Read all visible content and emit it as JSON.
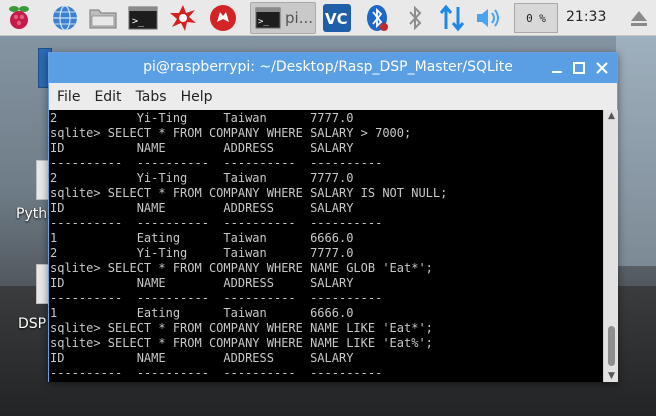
{
  "taskbar": {
    "task_label": "pi...",
    "cpu_usage": "0 %",
    "clock": "21:33",
    "icons": [
      "raspberry-pi-menu-icon",
      "web-browser-icon",
      "file-manager-icon",
      "terminal-icon",
      "burst-app-icon",
      "wolfram-icon",
      "vnc-icon",
      "bluetooth-icon",
      "network-icon",
      "volume-icon",
      "eject-icon"
    ]
  },
  "desktop": {
    "labels": [
      "Pyth",
      "DSP"
    ]
  },
  "window": {
    "title": "pi@raspberrypi: ~/Desktop/Rasp_DSP_Master/SQLite",
    "menu": [
      "File",
      "Edit",
      "Tabs",
      "Help"
    ]
  },
  "terminal": {
    "lines": [
      "2           Yi-Ting     Taiwan      7777.0",
      "sqlite> SELECT * FROM COMPANY WHERE SALARY > 7000;",
      "ID          NAME        ADDRESS     SALARY",
      "----------  ----------  ----------  ----------",
      "2           Yi-Ting     Taiwan      7777.0",
      "sqlite> SELECT * FROM COMPANY WHERE SALARY IS NOT NULL;",
      "ID          NAME        ADDRESS     SALARY",
      "----------  ----------  ----------  ----------",
      "1           Eating      Taiwan      6666.0",
      "2           Yi-Ting     Taiwan      7777.0",
      "sqlite> SELECT * FROM COMPANY WHERE NAME GLOB 'Eat*';",
      "ID          NAME        ADDRESS     SALARY",
      "----------  ----------  ----------  ----------",
      "1           Eating      Taiwan      6666.0",
      "sqlite> SELECT * FROM COMPANY WHERE NAME LIKE 'Eat*';",
      "sqlite> SELECT * FROM COMPANY WHERE NAME LIKE 'Eat%';",
      "ID          NAME        ADDRESS     SALARY",
      "----------  ----------  ----------  ----------"
    ]
  }
}
